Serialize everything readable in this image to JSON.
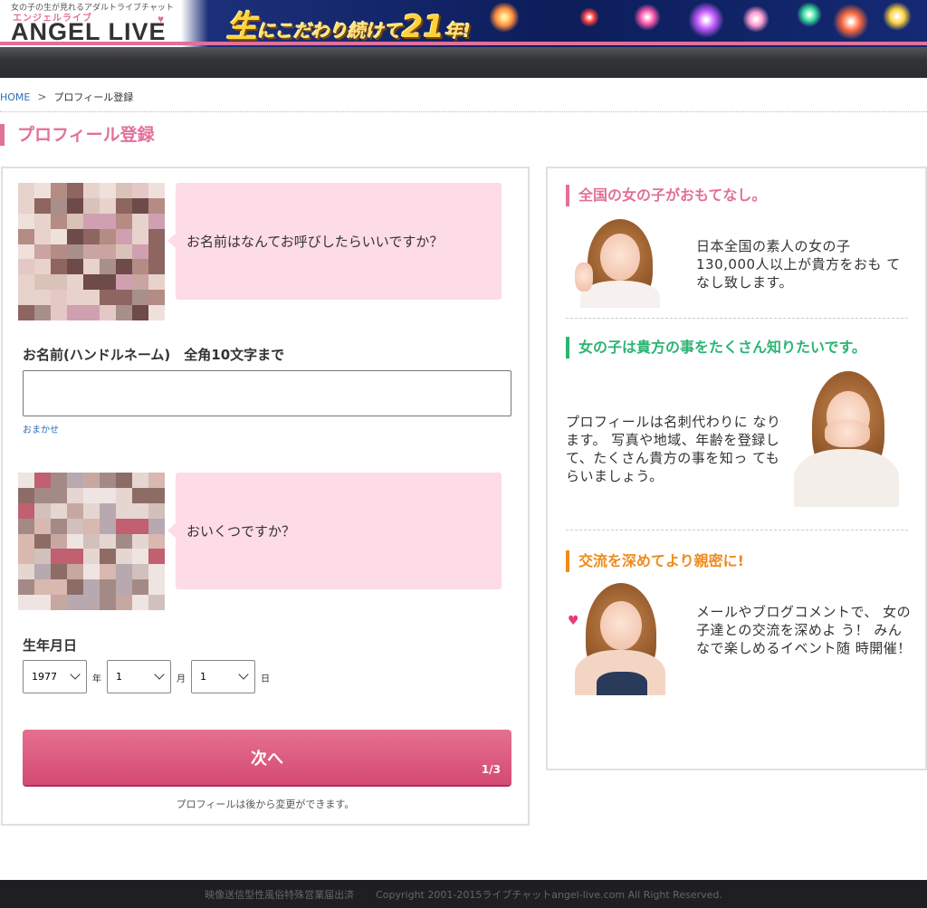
{
  "header": {
    "tagline": "女の子の生が見れるアダルトライブチャット",
    "logo_kana": "エンジェルライブ",
    "logo": "ANGEL LIVE",
    "banner_big": "生",
    "banner_mid": "にこだわり続けて",
    "banner_num": "21",
    "banner_end": "年!"
  },
  "breadcrumb": {
    "home": "HOME",
    "separator": ">",
    "current": "プロフィール登録"
  },
  "page_title": "プロフィール登録",
  "form": {
    "q1": "お名前はなんてお呼びしたらいいですか？",
    "name_label": "お名前(ハンドルネーム)　全角10文字まで",
    "name_value": "",
    "name_placeholder": "",
    "omakase": "おまかせ",
    "q2": "おいくつですか？",
    "birthday_label": "生年月日",
    "year_value": "1977",
    "year_unit": "年",
    "month_value": "1",
    "month_unit": "月",
    "day_value": "1",
    "day_unit": "日",
    "next_label": "次へ",
    "step": "1/3",
    "note": "プロフィールは後から変更ができます。"
  },
  "sidebar": {
    "sections": [
      {
        "title": "全国の女の子がおもてなし。",
        "color": "#e2709a",
        "text": "日本全国の素人の女の子 130,000人以上が貴方をおも てなし致します。"
      },
      {
        "title": "女の子は貴方の事をたくさん知りたいです。",
        "color": "#2bb573",
        "text": "プロフィールは名刺代わりに なります。 写真や地域、年齢を登録し て、たくさん貴方の事を知っ てもらいましょう。"
      },
      {
        "title": "交流を深めてより親密に!",
        "color": "#f08a1c",
        "text": "メールやブログコメントで、 女の子達との交流を深めよ う！ みんなで楽しめるイベント随 時開催！"
      }
    ]
  },
  "footer": {
    "license": "映像送信型性風俗特殊営業届出済",
    "copyright": "Copyright 2001-2015ライブチャットangel-live.com All Right Reserved."
  }
}
